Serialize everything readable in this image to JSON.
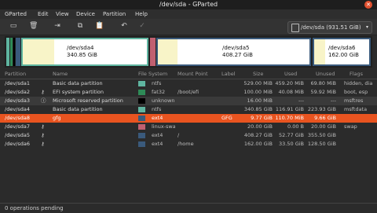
{
  "window": {
    "title": "/dev/sda - GParted",
    "close_glyph": "✕"
  },
  "menu": [
    "GParted",
    "Edit",
    "View",
    "Device",
    "Partition",
    "Help"
  ],
  "toolbar": {
    "icons": [
      "new-icon",
      "delete-icon",
      "resize-move-icon",
      "copy-icon",
      "paste-icon",
      "undo-icon",
      "apply-icon"
    ],
    "device_label": "/dev/sda (931.51 GiB)",
    "device_arrow": "▾"
  },
  "diskmap": [
    {
      "label": "/dev/sda4",
      "size": "340.85 GiB",
      "used_fraction": 0.25
    },
    {
      "label": "/dev/sda5",
      "size": "408.27 GiB",
      "used_fraction": 0.13
    },
    {
      "label": "/dev/sda6",
      "size": "162.00 GiB",
      "used_fraction": 0.2
    }
  ],
  "columns": [
    "Partition",
    "Name",
    "File System",
    "Mount Point",
    "Label",
    "Size",
    "Used",
    "Unused",
    "Flags"
  ],
  "partitions": [
    {
      "partition": "/dev/sda1",
      "flag_icon": "",
      "name": "Basic data partition",
      "fs": "ntfs",
      "fs_color": "#5fb5a0",
      "mount": "",
      "label": "",
      "size": "529.00 MiB",
      "used": "459.20 MiB",
      "unused": "69.80 MiB",
      "flags": "hidden, dia"
    },
    {
      "partition": "/dev/sda2",
      "flag_icon": "key",
      "name": "EFI system partition",
      "fs": "fat32",
      "fs_color": "#2e8b57",
      "mount": "/boot/efi",
      "label": "",
      "size": "100.00 MiB",
      "used": "40.08 MiB",
      "unused": "59.92 MiB",
      "flags": "boot, esp"
    },
    {
      "partition": "/dev/sda3",
      "flag_icon": "info",
      "name": "Microsoft reserved partition",
      "fs": "unknown",
      "fs_color": "#000000",
      "mount": "",
      "label": "",
      "size": "16.00 MiB",
      "used": "---",
      "unused": "---",
      "flags": "msftres"
    },
    {
      "partition": "/dev/sda4",
      "flag_icon": "",
      "name": "Basic data partition",
      "fs": "ntfs",
      "fs_color": "#5fb5a0",
      "mount": "",
      "label": "",
      "size": "340.85 GiB",
      "used": "116.91 GiB",
      "unused": "223.93 GiB",
      "flags": "msftdata"
    },
    {
      "partition": "/dev/sda8",
      "flag_icon": "",
      "name": "gfg",
      "fs": "ext4",
      "fs_color": "#3a5a7c",
      "mount": "",
      "label": "GFG",
      "size": "9.77 GiB",
      "used": "110.70 MiB",
      "unused": "9.66 GiB",
      "flags": "",
      "selected": true
    },
    {
      "partition": "/dev/sda7",
      "flag_icon": "key",
      "name": "",
      "fs": "linux-swap",
      "fs_color": "#c06070",
      "mount": "",
      "label": "",
      "size": "20.00 GiB",
      "used": "0.00 B",
      "unused": "20.00 GiB",
      "flags": "swap"
    },
    {
      "partition": "/dev/sda5",
      "flag_icon": "key",
      "name": "",
      "fs": "ext4",
      "fs_color": "#3a5a7c",
      "mount": "/",
      "label": "",
      "size": "408.27 GiB",
      "used": "52.77 GiB",
      "unused": "355.50 GiB",
      "flags": ""
    },
    {
      "partition": "/dev/sda6",
      "flag_icon": "key",
      "name": "",
      "fs": "ext4",
      "fs_color": "#3a5a7c",
      "mount": "/home",
      "label": "",
      "size": "162.00 GiB",
      "used": "33.50 GiB",
      "unused": "128.50 GiB",
      "flags": ""
    }
  ],
  "status": "0 operations pending"
}
